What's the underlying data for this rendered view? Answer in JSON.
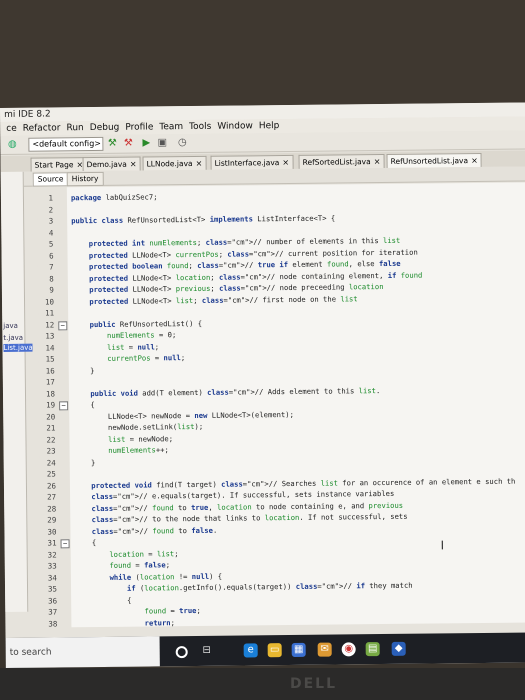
{
  "window": {
    "title": "mi IDE 8.2"
  },
  "menu": [
    "ce",
    "Refactor",
    "Run",
    "Debug",
    "Profile",
    "Team",
    "Tools",
    "Window",
    "Help"
  ],
  "toolbar": {
    "config": "<default config>"
  },
  "tabs": [
    {
      "label": "Start Page"
    },
    {
      "label": "Demo.java"
    },
    {
      "label": "LLNode.java"
    },
    {
      "label": "ListInterface.java"
    },
    {
      "label": "RefSortedList.java"
    },
    {
      "label": "RefUnsortedList.java"
    }
  ],
  "editor_tabs": {
    "source": "Source",
    "history": "History"
  },
  "project_items": [
    "java",
    "t.java",
    "List.java"
  ],
  "code_lines": [
    {
      "n": "1",
      "t": "package labQuizSec7;"
    },
    {
      "n": "2",
      "t": ""
    },
    {
      "n": "3",
      "t": "public class RefUnsortedList<T> implements ListInterface<T> {"
    },
    {
      "n": "4",
      "t": ""
    },
    {
      "n": "5",
      "t": "    protected int numElements; // number of elements in this list"
    },
    {
      "n": "6",
      "t": "    protected LLNode<T> currentPos; // current position for iteration"
    },
    {
      "n": "7",
      "t": "    protected boolean found; // true if element found, else false"
    },
    {
      "n": "8",
      "t": "    protected LLNode<T> location; // node containing element, if found"
    },
    {
      "n": "9",
      "t": "    protected LLNode<T> previous; // node preceeding location"
    },
    {
      "n": "10",
      "t": "    protected LLNode<T> list; // first node on the list"
    },
    {
      "n": "11",
      "t": ""
    },
    {
      "n": "12",
      "t": "    public RefUnsortedList() {"
    },
    {
      "n": "13",
      "t": "        numElements = 0;"
    },
    {
      "n": "14",
      "t": "        list = null;"
    },
    {
      "n": "15",
      "t": "        currentPos = null;"
    },
    {
      "n": "16",
      "t": "    }"
    },
    {
      "n": "17",
      "t": ""
    },
    {
      "n": "18",
      "t": "    public void add(T element) // Adds element to this list."
    },
    {
      "n": "19",
      "t": "    {"
    },
    {
      "n": "20",
      "t": "        LLNode<T> newNode = new LLNode<T>(element);"
    },
    {
      "n": "21",
      "t": "        newNode.setLink(list);"
    },
    {
      "n": "22",
      "t": "        list = newNode;"
    },
    {
      "n": "23",
      "t": "        numElements++;"
    },
    {
      "n": "24",
      "t": "    }"
    },
    {
      "n": "25",
      "t": ""
    },
    {
      "n": "26",
      "t": "    protected void find(T target) // Searches list for an occurence of an element e such th"
    },
    {
      "n": "27",
      "t": "    // e.equals(target). If successful, sets instance variables"
    },
    {
      "n": "28",
      "t": "    // found to true, location to node containing e, and previous"
    },
    {
      "n": "29",
      "t": "    // to the node that links to location. If not successful, sets"
    },
    {
      "n": "30",
      "t": "    // found to false."
    },
    {
      "n": "31",
      "t": "    {"
    },
    {
      "n": "32",
      "t": "        location = list;"
    },
    {
      "n": "33",
      "t": "        found = false;"
    },
    {
      "n": "34",
      "t": "        while (location != null) {"
    },
    {
      "n": "35",
      "t": "            if (location.getInfo().equals(target)) // if they match"
    },
    {
      "n": "36",
      "t": "            {"
    },
    {
      "n": "37",
      "t": "                found = true;"
    },
    {
      "n": "38",
      "t": "                return;"
    }
  ],
  "taskbar": {
    "search": "to search"
  },
  "brand": "DELL"
}
